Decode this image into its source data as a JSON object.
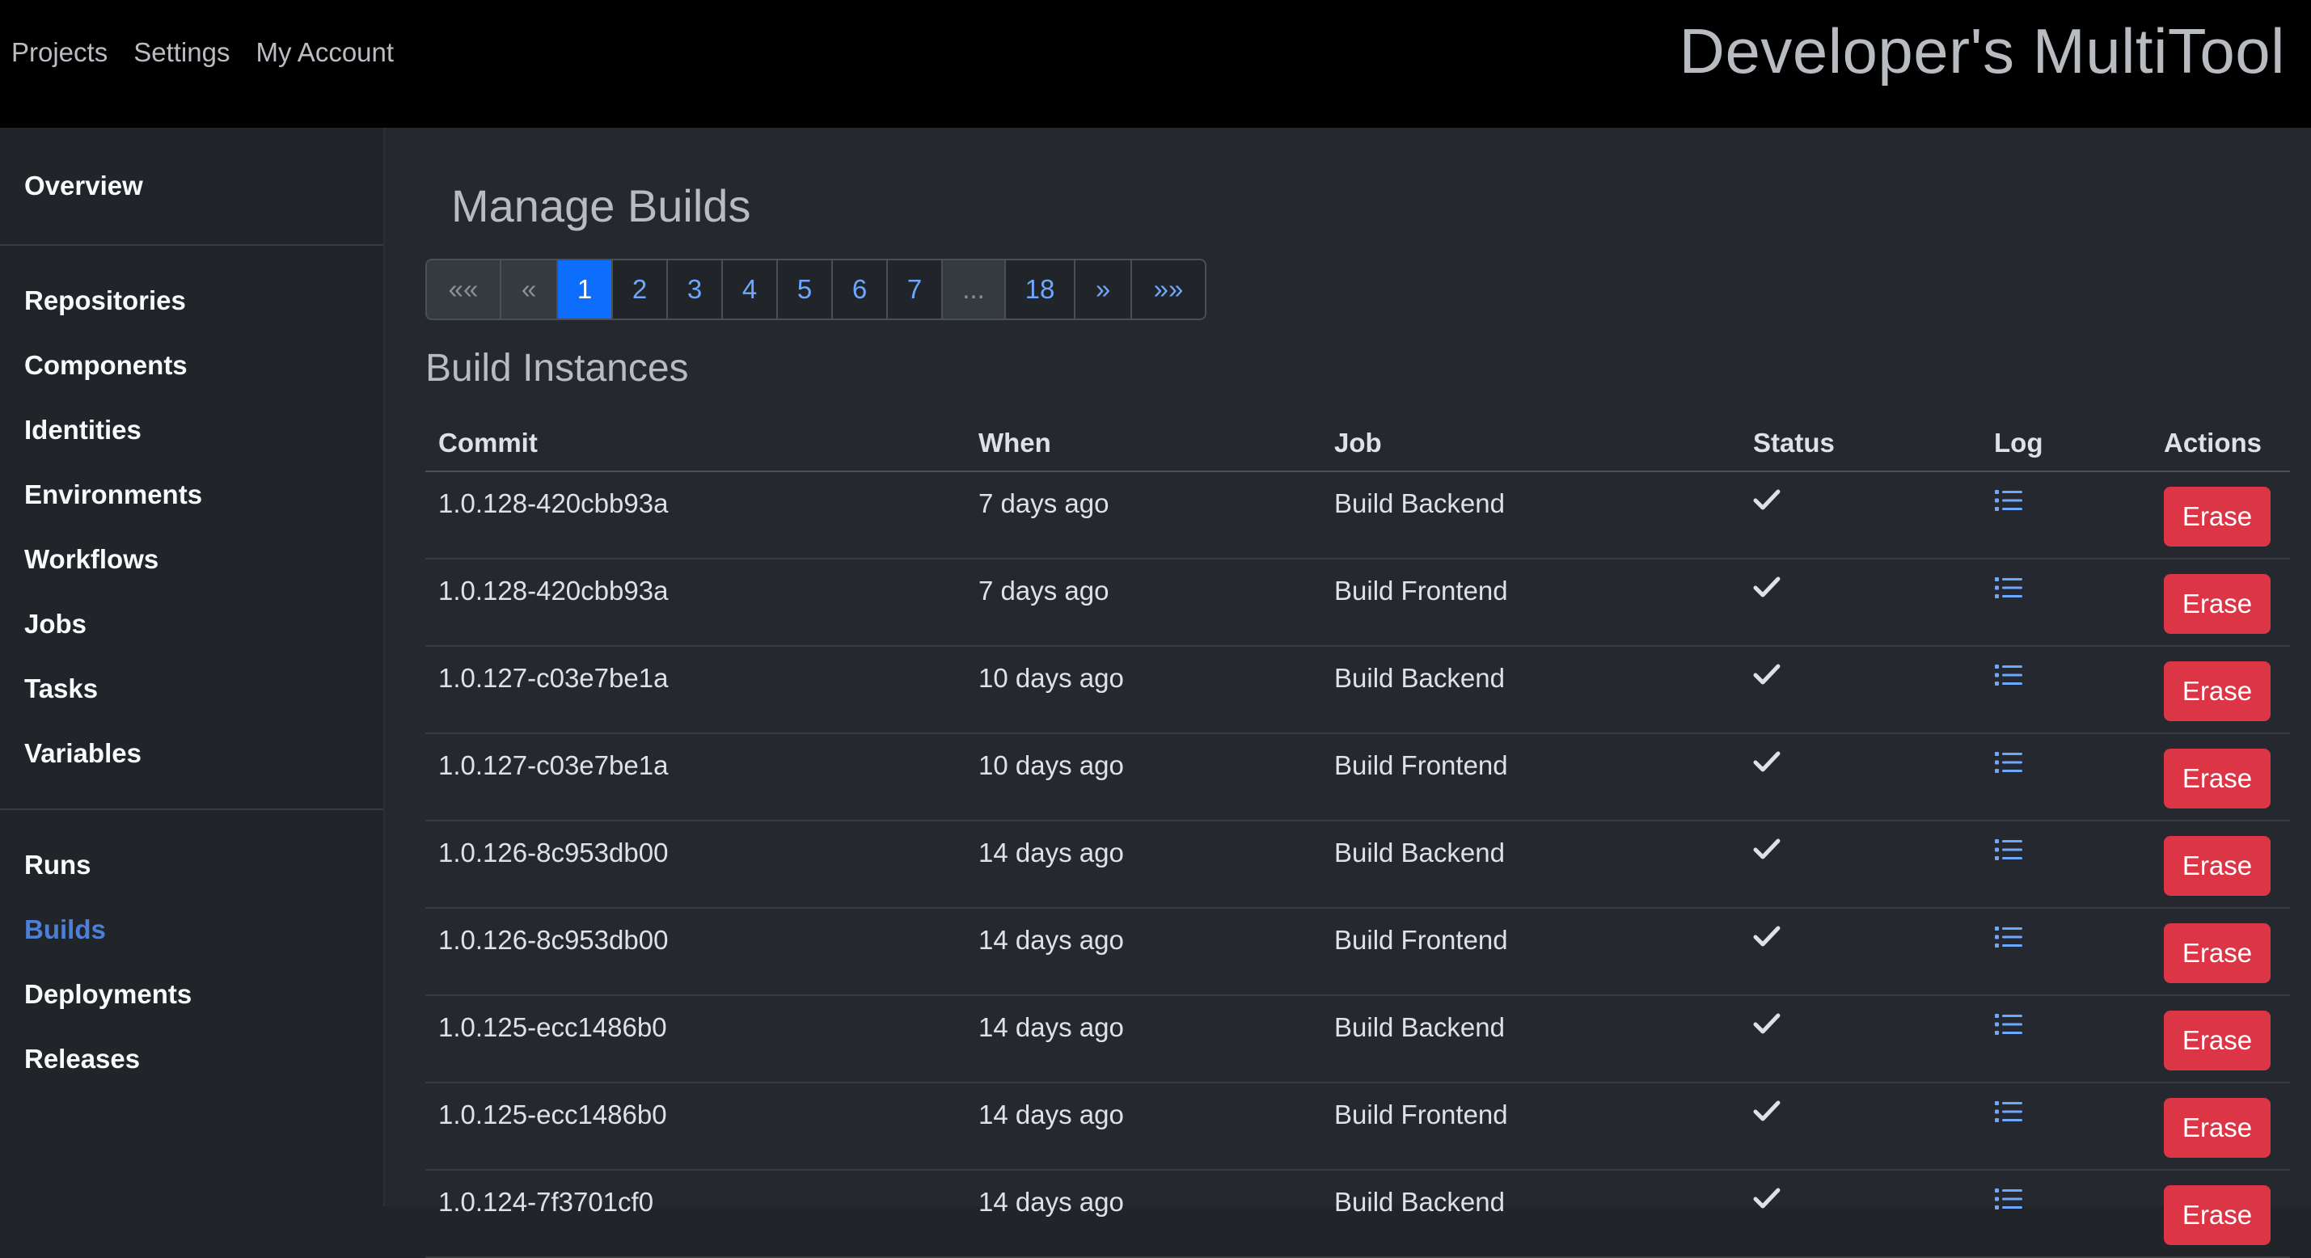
{
  "topbar": {
    "nav": [
      "Projects",
      "Settings",
      "My Account"
    ],
    "brand": "Developer's MultiTool"
  },
  "sidebar": {
    "groups": [
      [
        "Overview"
      ],
      [
        "Repositories",
        "Components",
        "Identities",
        "Environments",
        "Workflows",
        "Jobs",
        "Tasks",
        "Variables"
      ],
      [
        "Runs",
        "Builds",
        "Deployments",
        "Releases"
      ]
    ],
    "active": "Builds"
  },
  "main": {
    "title": "Manage Builds",
    "section_title": "Build Instances"
  },
  "pagination": {
    "first": "««",
    "prev": "«",
    "pages": [
      "1",
      "2",
      "3",
      "4",
      "5",
      "6",
      "7"
    ],
    "ellipsis": "...",
    "last_page": "18",
    "next": "»",
    "last": "»»",
    "current": "1"
  },
  "table": {
    "headers": [
      "Commit",
      "When",
      "Job",
      "Status",
      "Log",
      "Actions"
    ],
    "rows": [
      {
        "commit": "1.0.128-420cbb93a",
        "when": "7 days ago",
        "job": "Build Backend",
        "status": "success",
        "action": "Erase"
      },
      {
        "commit": "1.0.128-420cbb93a",
        "when": "7 days ago",
        "job": "Build Frontend",
        "status": "success",
        "action": "Erase"
      },
      {
        "commit": "1.0.127-c03e7be1a",
        "when": "10 days ago",
        "job": "Build Backend",
        "status": "success",
        "action": "Erase"
      },
      {
        "commit": "1.0.127-c03e7be1a",
        "when": "10 days ago",
        "job": "Build Frontend",
        "status": "success",
        "action": "Erase"
      },
      {
        "commit": "1.0.126-8c953db00",
        "when": "14 days ago",
        "job": "Build Backend",
        "status": "success",
        "action": "Erase"
      },
      {
        "commit": "1.0.126-8c953db00",
        "when": "14 days ago",
        "job": "Build Frontend",
        "status": "success",
        "action": "Erase"
      },
      {
        "commit": "1.0.125-ecc1486b0",
        "when": "14 days ago",
        "job": "Build Backend",
        "status": "success",
        "action": "Erase"
      },
      {
        "commit": "1.0.125-ecc1486b0",
        "when": "14 days ago",
        "job": "Build Frontend",
        "status": "success",
        "action": "Erase"
      },
      {
        "commit": "1.0.124-7f3701cf0",
        "when": "14 days ago",
        "job": "Build Backend",
        "status": "success",
        "action": "Erase"
      }
    ]
  },
  "colors": {
    "topbar_bg": "#000000",
    "sidebar_bg": "#212529",
    "main_bg": "#25282e",
    "accent": "#0d6efd",
    "link": "#6ea8fe",
    "active_nav": "#4d7fd6",
    "danger": "#dc3545"
  },
  "icons": {
    "status_success": "check-icon",
    "log": "list-icon"
  }
}
